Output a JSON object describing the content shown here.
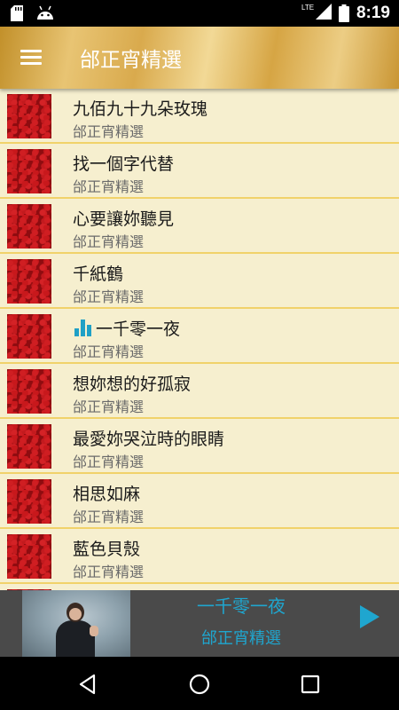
{
  "status_bar": {
    "time": "8:19",
    "network": "LTE",
    "icons": [
      "sd-card-icon",
      "android-icon",
      "lte-signal-icon",
      "battery-icon"
    ]
  },
  "app_bar": {
    "title": "邰正宵精選",
    "menu_icon": "hamburger-menu-icon"
  },
  "songs": [
    {
      "title": "九佰九十九朵玫瑰",
      "artist": "邰正宵精選",
      "playing": false
    },
    {
      "title": "找一個字代替",
      "artist": "邰正宵精選",
      "playing": false
    },
    {
      "title": "心要讓妳聽見",
      "artist": "邰正宵精選",
      "playing": false
    },
    {
      "title": "千紙鶴",
      "artist": "邰正宵精選",
      "playing": false
    },
    {
      "title": "一千零一夜",
      "artist": "邰正宵精選",
      "playing": true
    },
    {
      "title": "想妳想的好孤寂",
      "artist": "邰正宵精選",
      "playing": false
    },
    {
      "title": "最愛妳哭泣時的眼睛",
      "artist": "邰正宵精選",
      "playing": false
    },
    {
      "title": "相思如麻",
      "artist": "邰正宵精選",
      "playing": false
    },
    {
      "title": "藍色貝殼",
      "artist": "邰正宵精選",
      "playing": false
    }
  ],
  "player": {
    "title": "一千零一夜",
    "artist": "邰正宵精選",
    "play_icon": "play-icon"
  },
  "nav": {
    "icons": [
      "back-icon",
      "home-icon",
      "recents-icon"
    ]
  },
  "colors": {
    "accent": "#1fa6cf",
    "list_background": "#f6efcf",
    "divider": "#f1d26a",
    "player_background": "#4a4a4a"
  }
}
